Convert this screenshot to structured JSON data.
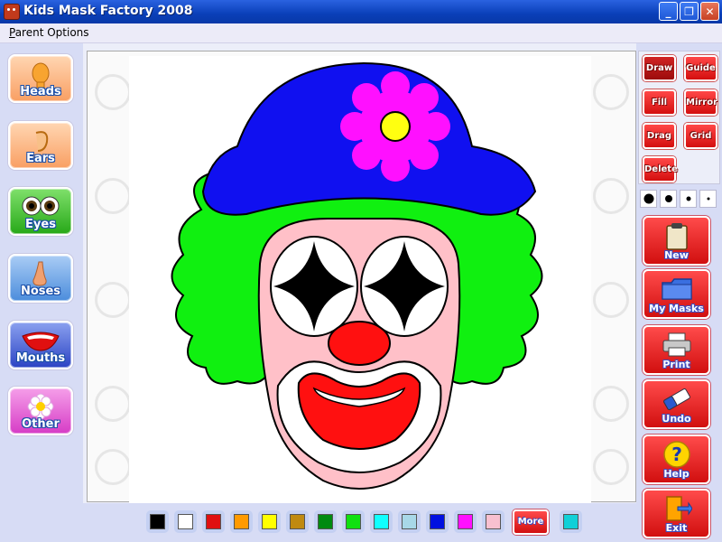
{
  "window": {
    "title": "Kids Mask Factory 2008",
    "min_glyph": "_",
    "max_glyph": "❐",
    "close_glyph": "✕"
  },
  "menu": {
    "first_letter": "P",
    "rest": "arent Options"
  },
  "categories": [
    {
      "label": "Heads",
      "icon": "head-icon",
      "color": "#f9a46f"
    },
    {
      "label": "Ears",
      "icon": "ear-icon",
      "color": "#f9a46f"
    },
    {
      "label": "Eyes",
      "icon": "eyes-icon",
      "color": "#3fbf2a"
    },
    {
      "label": "Noses",
      "icon": "nose-icon",
      "color": "#5a9ae0"
    },
    {
      "label": "Mouths",
      "icon": "mouth-icon",
      "color": "#3f56c8"
    },
    {
      "label": "Other",
      "icon": "flower-icon",
      "color": "#e14cd4"
    }
  ],
  "tools": [
    {
      "label": "Draw",
      "active": true
    },
    {
      "label": "Guide",
      "active": false
    },
    {
      "label": "Fill",
      "active": false
    },
    {
      "label": "Mirror",
      "active": false
    },
    {
      "label": "Drag",
      "active": false
    },
    {
      "label": "Grid",
      "active": false
    },
    {
      "label": "Delete",
      "active": false
    }
  ],
  "actions": [
    {
      "label": "New",
      "icon": "clipboard-icon"
    },
    {
      "label": "My Masks",
      "icon": "folder-icon"
    },
    {
      "label": "Print",
      "icon": "printer-icon"
    },
    {
      "label": "Undo",
      "icon": "eraser-icon"
    },
    {
      "label": "Help",
      "icon": "help-icon"
    },
    {
      "label": "Exit",
      "icon": "exit-door-icon"
    }
  ],
  "palette": [
    "#000000",
    "#ffffff",
    "#e01010",
    "#ff9a00",
    "#ffff00",
    "#c08a10",
    "#008a10",
    "#10e010",
    "#10ffff",
    "#a8d8e8",
    "#0010e0",
    "#ff10ff",
    "#f8c0d0"
  ],
  "more_label": "More",
  "selected_color": "#10d0d8",
  "mask_colors": {
    "hat": "#1010f0",
    "hair": "#10f010",
    "face": "#ffc0c8",
    "nose": "#ff1010",
    "mouth": "#ff1010",
    "flower": "#ff10ff",
    "flower_center": "#ffff10"
  }
}
